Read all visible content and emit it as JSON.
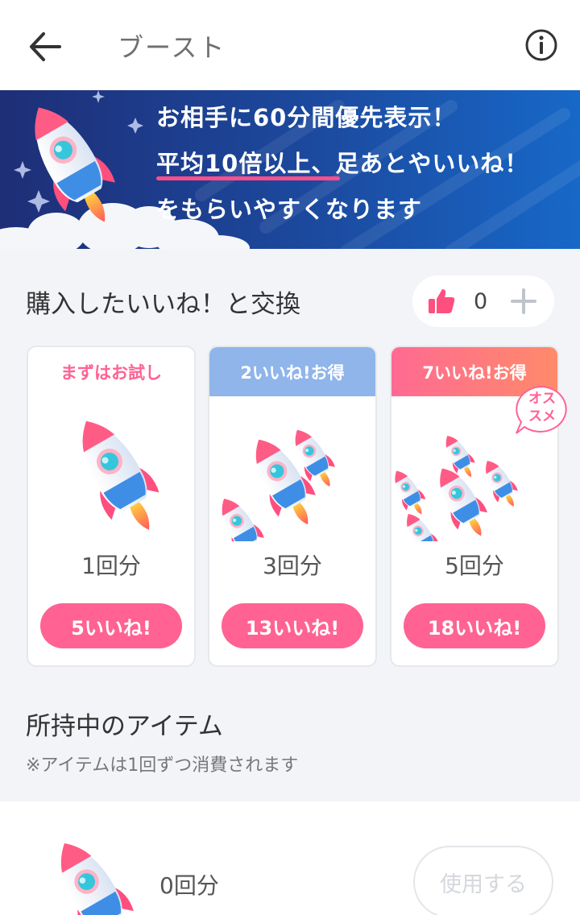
{
  "header": {
    "title": "ブースト",
    "back_icon": "arrow-left-icon",
    "info_icon": "info-circle-icon"
  },
  "banner": {
    "line1": "お相手に60分間優先表示！",
    "line2_highlight": "平均10倍以上、",
    "line2_rest": "足あとやいいね！",
    "line3": "をもらいやすくなります"
  },
  "exchange": {
    "title": "購入したいいね！と交換",
    "like_count": "0",
    "like_icon": "thumbs-up-icon",
    "add_icon": "plus-icon"
  },
  "plans": [
    {
      "header": "まずはお試し",
      "quantity": "1回分",
      "price_button": "5いいね!"
    },
    {
      "header": "2いいね!お得",
      "quantity": "3回分",
      "price_button": "13いいね!"
    },
    {
      "header": "7いいね!お得",
      "quantity": "5回分",
      "price_button": "18いいね!",
      "badge_line1": "オス",
      "badge_line2": "スメ"
    }
  ],
  "owned": {
    "title": "所持中のアイテム",
    "note": "※アイテムは1回ずつ消費されます",
    "quantity": "0回分",
    "use_button": "使用する"
  },
  "colors": {
    "accent_pink": "#ff6293",
    "banner_blue": "#1c4a9f",
    "plan2_header": "#8fb5ea"
  }
}
